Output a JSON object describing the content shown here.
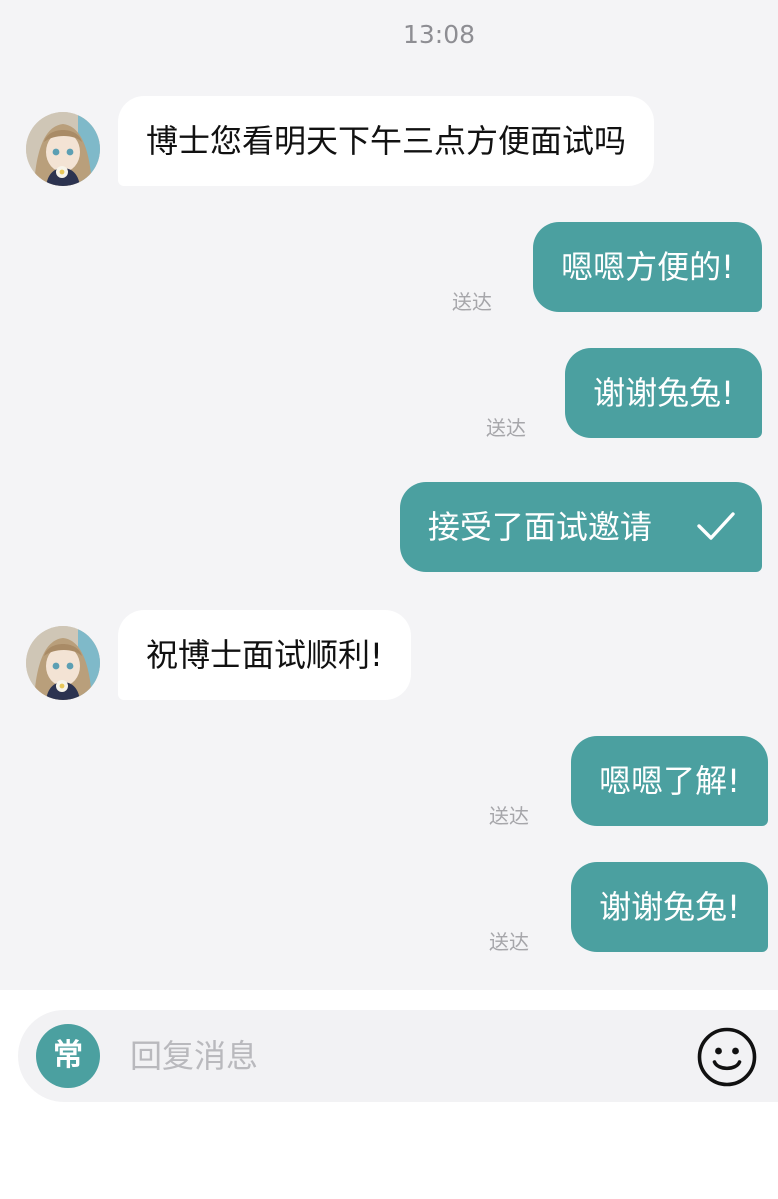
{
  "header": {
    "timestamp": "13:08"
  },
  "messages": [
    {
      "direction": "incoming",
      "text": "博士您看明天下午三点方便面试吗"
    },
    {
      "direction": "outgoing",
      "text": "嗯嗯方便的!",
      "status": "送达"
    },
    {
      "direction": "outgoing",
      "text": "谢谢兔兔!",
      "status": "送达"
    },
    {
      "direction": "outgoing",
      "text": "接受了面试邀请",
      "icon": "check-icon"
    },
    {
      "direction": "incoming",
      "text": "祝博士面试顺利!"
    },
    {
      "direction": "outgoing",
      "text": "嗯嗯了解!",
      "status": "送达"
    },
    {
      "direction": "outgoing",
      "text": "谢谢兔兔!",
      "status": "送达"
    }
  ],
  "composer": {
    "quick_reply_label": "常",
    "placeholder": "回复消息",
    "value": "",
    "emoji_icon": "smiley-icon"
  },
  "colors": {
    "accent": "#4ba0a0",
    "background": "#f4f4f6",
    "incoming_bubble": "#ffffff",
    "status_text": "#a6a6aa"
  }
}
